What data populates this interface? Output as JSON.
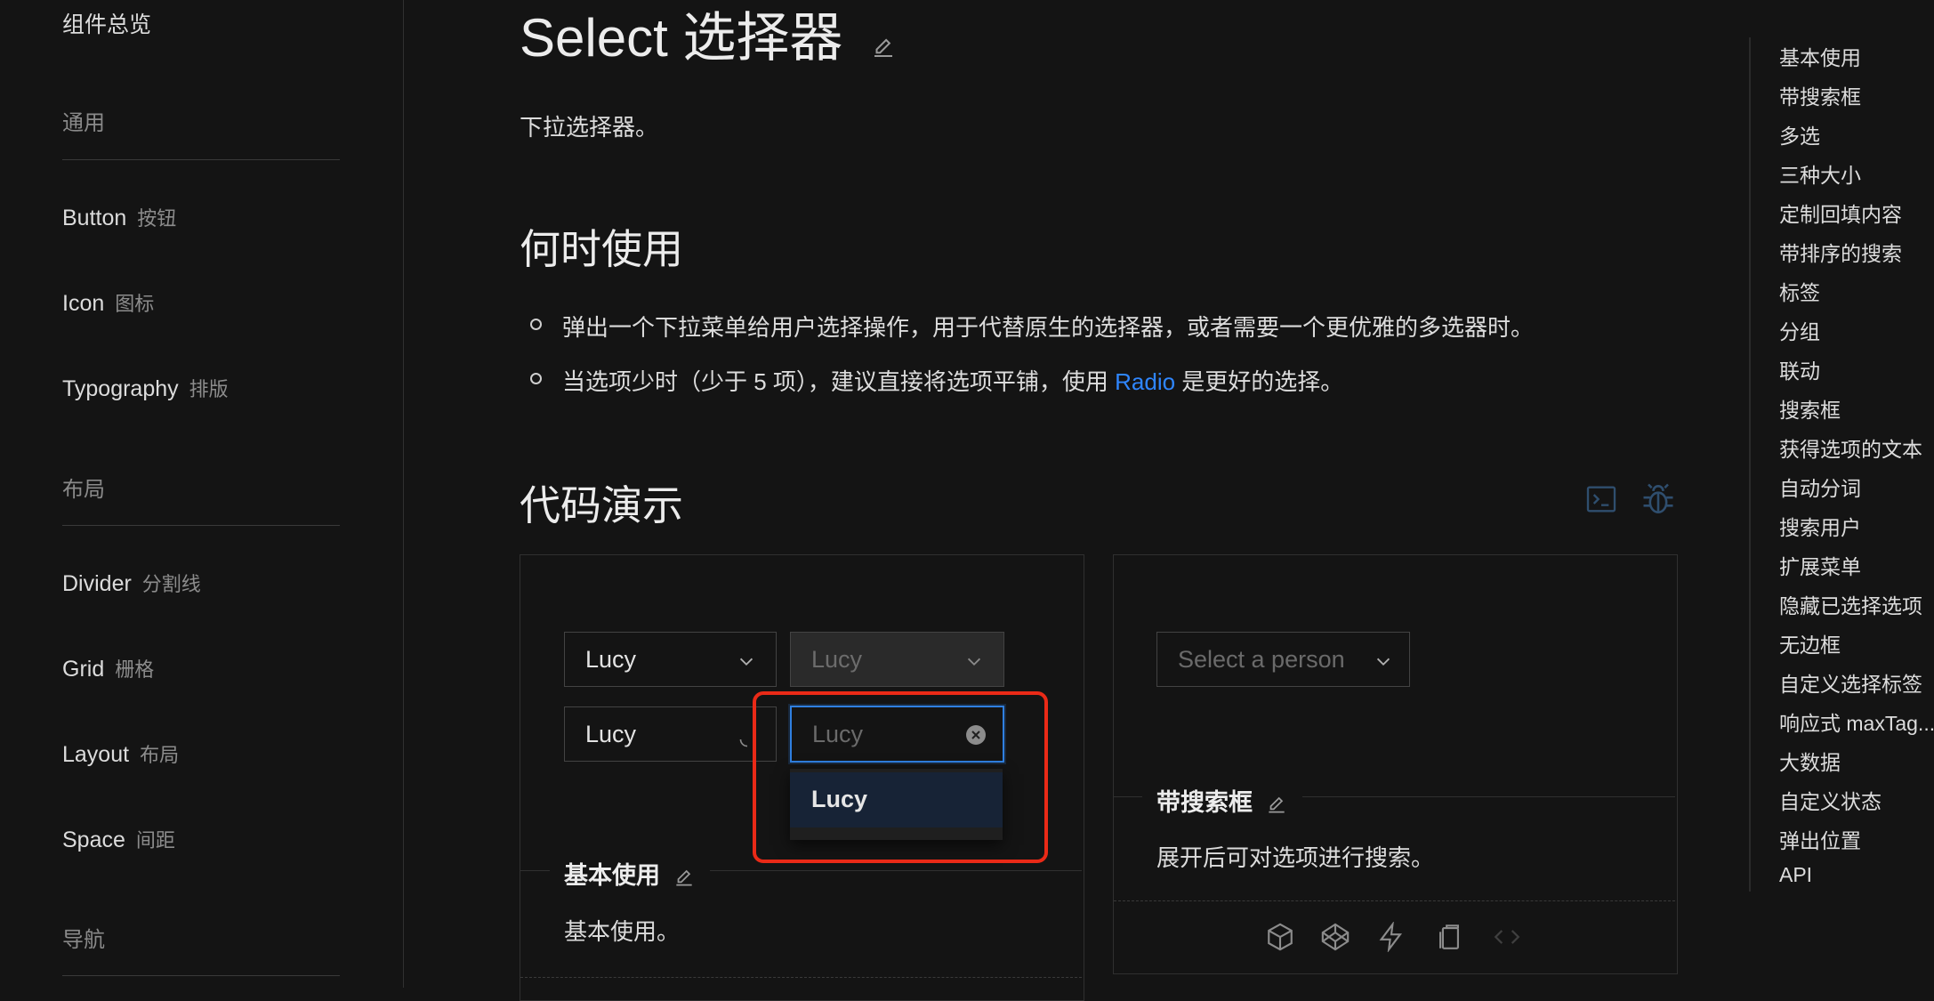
{
  "sidebar": {
    "top_label": "组件总览",
    "groups": [
      {
        "label": "通用"
      },
      {
        "label": "布局"
      },
      {
        "label": "导航"
      }
    ],
    "items": [
      {
        "label": "Button",
        "sub": "按钮"
      },
      {
        "label": "Icon",
        "sub": "图标"
      },
      {
        "label": "Typography",
        "sub": "排版"
      },
      {
        "label": "Divider",
        "sub": "分割线"
      },
      {
        "label": "Grid",
        "sub": "栅格"
      },
      {
        "label": "Layout",
        "sub": "布局"
      },
      {
        "label": "Space",
        "sub": "间距"
      }
    ]
  },
  "page": {
    "title": "Select 选择器",
    "description": "下拉选择器。",
    "when_heading": "何时使用",
    "bullet1": "弹出一个下拉菜单给用户选择操作，用于代替原生的选择器，或者需要一个更优雅的多选器时。",
    "bullet2_pre": "当选项少时（少于 5 项），建议直接将选项平铺，使用 ",
    "bullet2_link": "Radio",
    "bullet2_post": " 是更好的选择。",
    "demo_heading": "代码演示"
  },
  "demo_basic": {
    "select1": "Lucy",
    "select2": "Lucy",
    "select3": "Lucy",
    "select4_placeholder": "Lucy",
    "dropdown_option": "Lucy",
    "title": "基本使用",
    "desc": "基本使用。"
  },
  "demo_search": {
    "placeholder": "Select a person",
    "title": "带搜索框",
    "desc": "展开后可对选项进行搜索。"
  },
  "anchor": {
    "items": [
      "基本使用",
      "带搜索框",
      "多选",
      "三种大小",
      "定制回填内容",
      "带排序的搜索",
      "标签",
      "分组",
      "联动",
      "搜索框",
      "获得选项的文本",
      "自动分词",
      "搜索用户",
      "扩展菜单",
      "隐藏已选择选项",
      "无边框",
      "自定义选择标签",
      "响应式 maxTag...",
      "大数据",
      "自定义状态",
      "弹出位置",
      "API"
    ]
  },
  "colors": {
    "background": "#141414",
    "link": "#2f86ff",
    "focus_border": "#2f7fe0",
    "highlight": "#ea2a17"
  }
}
